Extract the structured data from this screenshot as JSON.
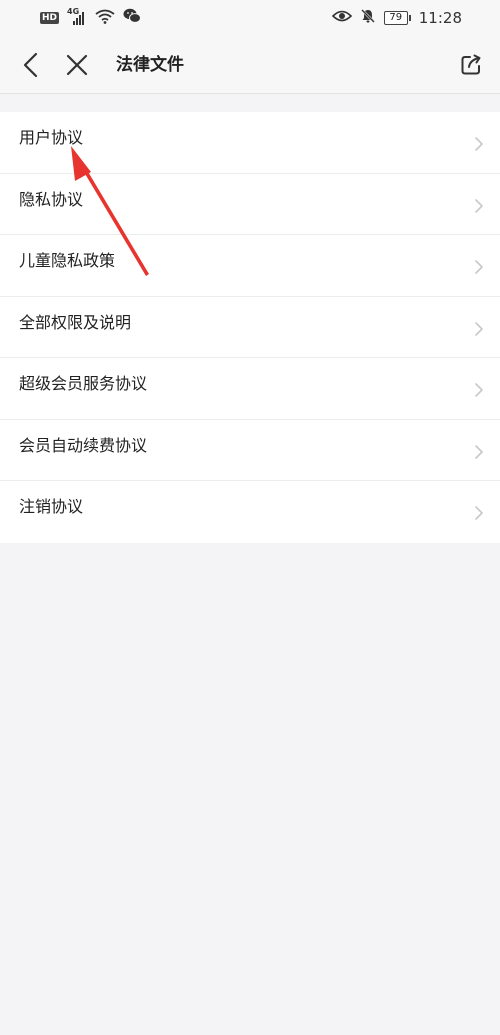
{
  "status_bar": {
    "hd_badge": "HD",
    "network": "4G",
    "battery_level": "79",
    "time": "11:28"
  },
  "nav": {
    "title": "法律文件"
  },
  "list": {
    "items": [
      {
        "label": "用户协议"
      },
      {
        "label": "隐私协议"
      },
      {
        "label": "儿童隐私政策"
      },
      {
        "label": "全部权限及说明"
      },
      {
        "label": "超级会员服务协议"
      },
      {
        "label": "会员自动续费协议"
      },
      {
        "label": "注销协议"
      }
    ]
  },
  "colors": {
    "background": "#f4f4f6",
    "list_background": "#ffffff",
    "text": "#222222",
    "chevron": "#c8c8c8",
    "annotation": "#e8342e"
  },
  "icons": {
    "back": "chevron-left-icon",
    "close": "close-icon",
    "share": "share-icon",
    "row_arrow": "chevron-right-icon"
  }
}
